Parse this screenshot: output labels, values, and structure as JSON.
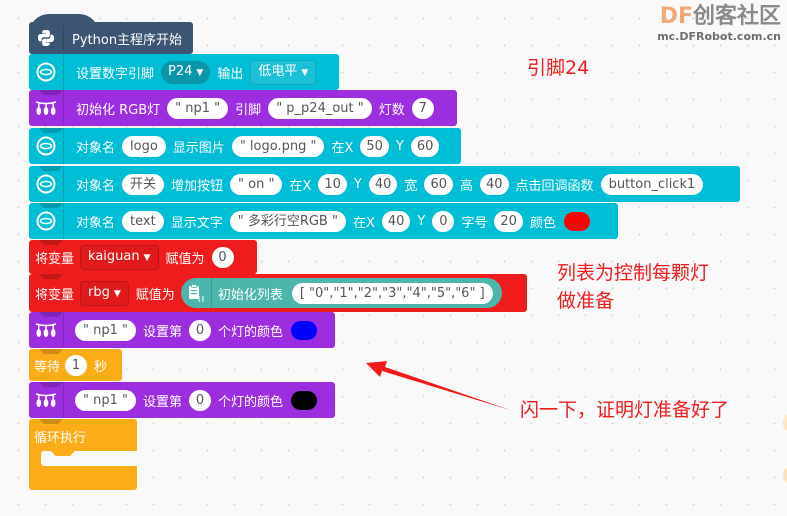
{
  "watermark": {
    "brand_df": "DF",
    "brand_cn": "创客社区",
    "url": "mc.DFRobot.com.cn"
  },
  "blocks": {
    "start": {
      "label": "Python主程序开始",
      "icon": "python-icon"
    },
    "set_pin": {
      "label": "设置数字引脚",
      "pin": "P24",
      "label2": "输出",
      "level": "低电平"
    },
    "init_rgb": {
      "label": "初始化 RGB灯",
      "name": "\" np1 \"",
      "label2": "引脚",
      "pin": "\" p_p24_out \"",
      "label3": "灯数",
      "count": "7"
    },
    "show_image": {
      "label": "对象名",
      "obj": "logo",
      "label2": "显示图片",
      "file": "\" logo.png \"",
      "label_x": "在X",
      "x": "50",
      "label_y": "Y",
      "y": "60"
    },
    "add_button": {
      "label": "对象名",
      "obj": "开关",
      "label2": "增加按钮",
      "text": "\" on \"",
      "label_x": "在X",
      "x": "10",
      "label_y": "Y",
      "y": "40",
      "label_w": "宽",
      "w": "60",
      "label_h": "高",
      "h": "40",
      "label_cb": "点击回调函数",
      "cb": "button_click1"
    },
    "show_text": {
      "label": "对象名",
      "obj": "text",
      "label2": "显示文字",
      "text": "\" 多彩行空RGB \"",
      "label_x": "在X",
      "x": "40",
      "label_y": "Y",
      "y": "0",
      "label_size": "字号",
      "size": "20",
      "label_color": "颜色",
      "color": "#ff0000"
    },
    "set_var1": {
      "label": "将变量",
      "var": "kaiguan",
      "label2": "赋值为",
      "value": "0"
    },
    "set_var2": {
      "label": "将变量",
      "var": "rbg",
      "label2": "赋值为",
      "list_label": "初始化列表",
      "list": "[ \"0\",\"1\",\"2\",\"3\",\"4\",\"5\",\"6\" ]"
    },
    "set_led1": {
      "name": "\" np1 \"",
      "label": "设置第",
      "index": "0",
      "label2": "个灯的颜色",
      "color": "#0000ff"
    },
    "wait": {
      "label": "等待",
      "value": "1",
      "unit": "秒"
    },
    "set_led2": {
      "name": "\" np1 \"",
      "label": "设置第",
      "index": "0",
      "label2": "个灯的颜色",
      "color": "#000000"
    },
    "loop": {
      "label": "循环执行"
    }
  },
  "annotations": {
    "pin_note": "引脚24",
    "list_note_line1": "列表为控制每颗灯",
    "list_note_line2": "做准备",
    "flash_note": "闪一下，证明灯准备好了"
  }
}
